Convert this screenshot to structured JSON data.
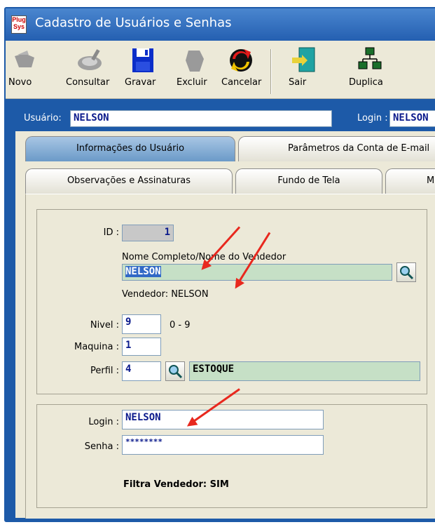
{
  "window": {
    "title": "Cadastro de Usuários e Senhas",
    "icon_text": "Plug\nSys"
  },
  "toolbar": {
    "novo": "Novo",
    "consultar": "Consultar",
    "gravar": "Gravar",
    "excluir": "Excluir",
    "cancelar": "Cancelar",
    "sair": "Sair",
    "duplica": "Duplica"
  },
  "header": {
    "usuario_label": "Usuário:",
    "usuario_value": "NELSON",
    "login_label": "Login :",
    "login_value": "NELSON"
  },
  "tabs": {
    "row1": [
      "Informações do Usuário",
      "Parâmetros da Conta de E-mail"
    ],
    "row2": [
      "Observações e Assinaturas",
      "Fundo de Tela",
      "M"
    ]
  },
  "form": {
    "id_label": "ID :",
    "id_value": "1",
    "nome_label": "Nome Completo/Nome do Vendedor",
    "nome_value": "NELSON",
    "vendedor_text": "Vendedor: NELSON",
    "nivel_label": "Nivel :",
    "nivel_value": "9",
    "nivel_range": "0 - 9",
    "maquina_label": "Maquina :",
    "maquina_value": "1",
    "perfil_label": "Perfil :",
    "perfil_value": "4",
    "perfil_name": "ESTOQUE"
  },
  "credentials": {
    "login_label": "Login :",
    "login_value": "NELSON",
    "senha_label": "Senha :",
    "senha_value": "********",
    "filtra_text": "Filtra Vendedor: SIM"
  },
  "colors": {
    "accent_blue": "#1d5aa8",
    "highlight_green": "#c6e0c6",
    "arrow_red": "#e8281e"
  }
}
